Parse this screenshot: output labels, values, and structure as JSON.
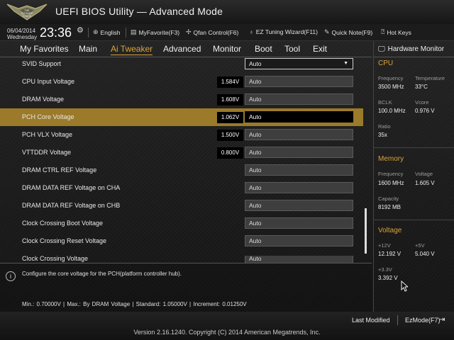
{
  "app": {
    "title": "UEFI BIOS Utility — Advanced Mode",
    "logo_text_1": "THE",
    "logo_text_2": "ULTIMATE",
    "logo_text_3": "FORCE"
  },
  "info": {
    "date": "06/04/2014",
    "day": "Wednesday",
    "time": "23:36",
    "language": "English",
    "myfavorite": "MyFavorite(F3)",
    "qfan": "Qfan Control(F6)",
    "ez_tuning": "EZ Tuning Wizard(F11)",
    "quick_note": "Quick Note(F9)",
    "hot_keys": "Hot Keys"
  },
  "tabs": [
    {
      "label": "My Favorites"
    },
    {
      "label": "Main"
    },
    {
      "label": "Ai Tweaker"
    },
    {
      "label": "Advanced"
    },
    {
      "label": "Monitor"
    },
    {
      "label": "Boot"
    },
    {
      "label": "Tool"
    },
    {
      "label": "Exit"
    }
  ],
  "settings": [
    {
      "label": "SVID Support",
      "current": "",
      "value": "Auto"
    },
    {
      "label": "CPU Input Voltage",
      "current": "1.584V",
      "value": "Auto"
    },
    {
      "label": "DRAM Voltage",
      "current": "1.608V",
      "value": "Auto"
    },
    {
      "label": "PCH Core Voltage",
      "current": "1.062V",
      "value": "Auto"
    },
    {
      "label": "PCH VLX Voltage",
      "current": "1.500V",
      "value": "Auto"
    },
    {
      "label": "VTTDDR Voltage",
      "current": "0.800V",
      "value": "Auto"
    },
    {
      "label": "DRAM CTRL REF Voltage",
      "current": "",
      "value": "Auto"
    },
    {
      "label": "DRAM DATA REF Voltage on CHA",
      "current": "",
      "value": "Auto"
    },
    {
      "label": "DRAM DATA REF Voltage on CHB",
      "current": "",
      "value": "Auto"
    },
    {
      "label": "Clock Crossing Boot Voltage",
      "current": "",
      "value": "Auto"
    },
    {
      "label": "Clock Crossing Reset Voltage",
      "current": "",
      "value": "Auto"
    },
    {
      "label": "Clock Crossing Voltage",
      "current": "",
      "value": "Auto"
    }
  ],
  "help": {
    "text": "Configure the core voltage for the PCH(platform controller hub).",
    "range": "Min.: 0.70000V   |   Max.: By DRAM Voltage   |   Standard: 1.05000V   |   Increment: 0.01250V"
  },
  "hw": {
    "title": "Hardware Monitor",
    "cpu": {
      "heading": "CPU",
      "freq_label": "Frequency",
      "freq": "3500 MHz",
      "temp_label": "Temperature",
      "temp": "33°C",
      "bclk_label": "BCLK",
      "bclk": "100.0 MHz",
      "vcore_label": "Vcore",
      "vcore": "0.976 V",
      "ratio_label": "Ratio",
      "ratio": "35x"
    },
    "memory": {
      "heading": "Memory",
      "freq_label": "Frequency",
      "freq": "1600 MHz",
      "volt_label": "Voltage",
      "volt": "1.605 V",
      "cap_label": "Capacity",
      "cap": "8192 MB"
    },
    "voltage": {
      "heading": "Voltage",
      "v12_label": "+12V",
      "v12": "12.192 V",
      "v5_label": "+5V",
      "v5": "5.040 V",
      "v33_label": "+3.3V",
      "v33": "3.392 V"
    }
  },
  "bottom": {
    "last_modified": "Last Modified",
    "ezmode": "EzMode(F7)",
    "version": "Version 2.16.1240. Copyright (C) 2014 American Megatrends, Inc."
  },
  "colors": {
    "accent": "#d9a33a",
    "selected_row": "#9b7a2a"
  }
}
